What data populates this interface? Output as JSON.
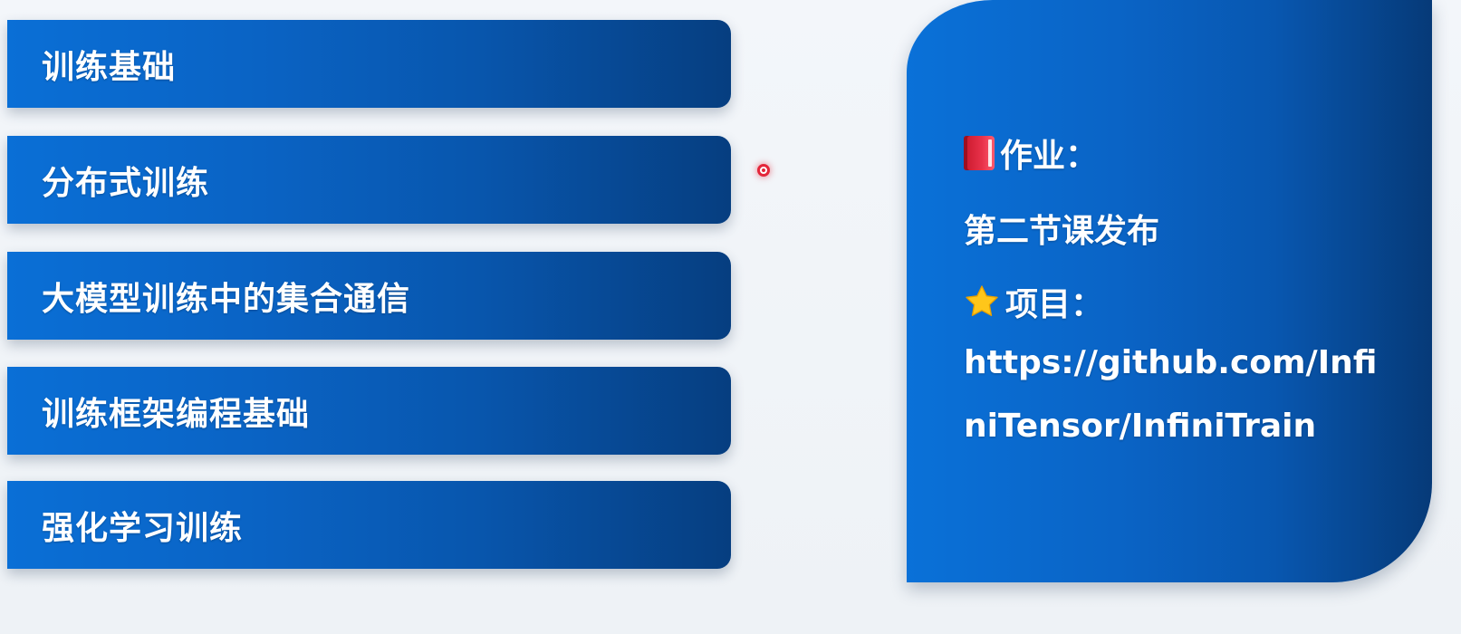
{
  "topics": [
    {
      "label": "训练基础"
    },
    {
      "label": "分布式训练"
    },
    {
      "label": "大模型训练中的集合通信"
    },
    {
      "label": "训练框架编程基础"
    },
    {
      "label": "强化学习训练"
    }
  ],
  "panel": {
    "homework_icon": "book-icon",
    "homework_label": "作业：",
    "homework_value": "第二节课发布",
    "project_icon": "star-icon",
    "project_label": "项目：",
    "project_url_line1": "https://github.com/Infi",
    "project_url_line2": "niTensor/InfiniTrain"
  },
  "colors": {
    "card_start": "#0a6fd6",
    "card_end": "#063e80",
    "laser": "#e3263a"
  }
}
